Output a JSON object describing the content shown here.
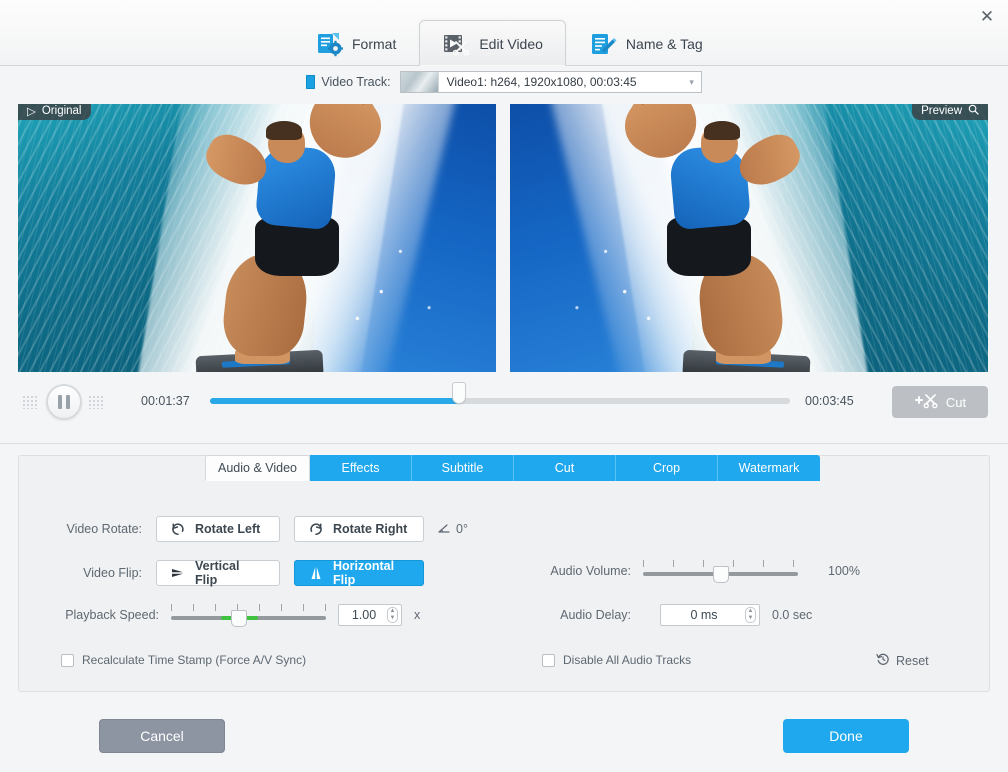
{
  "window": {
    "close_label": "✕"
  },
  "top_tabs": [
    {
      "label": "Format",
      "icon": "format-gear-icon",
      "active": false
    },
    {
      "label": "Edit Video",
      "icon": "film-scissors-icon",
      "active": true
    },
    {
      "label": "Name & Tag",
      "icon": "document-pencil-icon",
      "active": false
    }
  ],
  "track": {
    "label": "Video Track:",
    "icon": "video-track-icon",
    "selected": "Video1: h264, 1920x1080, 00:03:45",
    "caret": "▾"
  },
  "preview": {
    "original_label": "Original",
    "original_icon": "play-triangle-icon",
    "preview_label": "Preview",
    "preview_icon": "magnifier-icon"
  },
  "transport": {
    "play_state": "paused",
    "play_icon": "pause-icon",
    "current_time": "00:01:37",
    "total_time": "00:03:45",
    "progress_percent": 43,
    "cut_label": "Cut",
    "cut_icon": "add-scissors-icon"
  },
  "sub_tabs": [
    {
      "label": "Audio & Video",
      "active": true
    },
    {
      "label": "Effects",
      "active": false
    },
    {
      "label": "Subtitle",
      "active": false
    },
    {
      "label": "Cut",
      "active": false
    },
    {
      "label": "Crop",
      "active": false
    },
    {
      "label": "Watermark",
      "active": false
    }
  ],
  "controls": {
    "video_rotate_label": "Video Rotate:",
    "rotate_left_label": "Rotate Left",
    "rotate_left_icon": "rotate-ccw-icon",
    "rotate_right_label": "Rotate Right",
    "rotate_right_icon": "rotate-cw-icon",
    "angle_icon": "angle-icon",
    "angle_value": "0°",
    "video_flip_label": "Video Flip:",
    "vertical_flip_label": "Vertical Flip",
    "vertical_flip_icon": "vertical-flip-icon",
    "vertical_flip_active": false,
    "horizontal_flip_label": "Horizontal Flip",
    "horizontal_flip_icon": "horizontal-flip-icon",
    "horizontal_flip_active": true,
    "playback_speed_label": "Playback Speed:",
    "playback_speed_value": "1.00",
    "playback_speed_unit": "x",
    "playback_speed_percent": 44,
    "audio_volume_label": "Audio Volume:",
    "audio_volume_value": "100%",
    "audio_volume_percent": 50,
    "audio_delay_label": "Audio Delay:",
    "audio_delay_value": "0 ms",
    "audio_delay_seconds": "0.0 sec",
    "recalc_label": "Recalculate Time Stamp (Force A/V Sync)",
    "recalc_checked": false,
    "disable_audio_label": "Disable All Audio Tracks",
    "disable_audio_checked": false,
    "reset_label": "Reset",
    "reset_icon": "reset-clock-icon"
  },
  "footer": {
    "cancel_label": "Cancel",
    "done_label": "Done"
  },
  "colors": {
    "accent": "#1fa8ed",
    "progress": "#29a8e8",
    "speed_green": "#3fc23f",
    "cancel_gray": "#8d95a3"
  }
}
